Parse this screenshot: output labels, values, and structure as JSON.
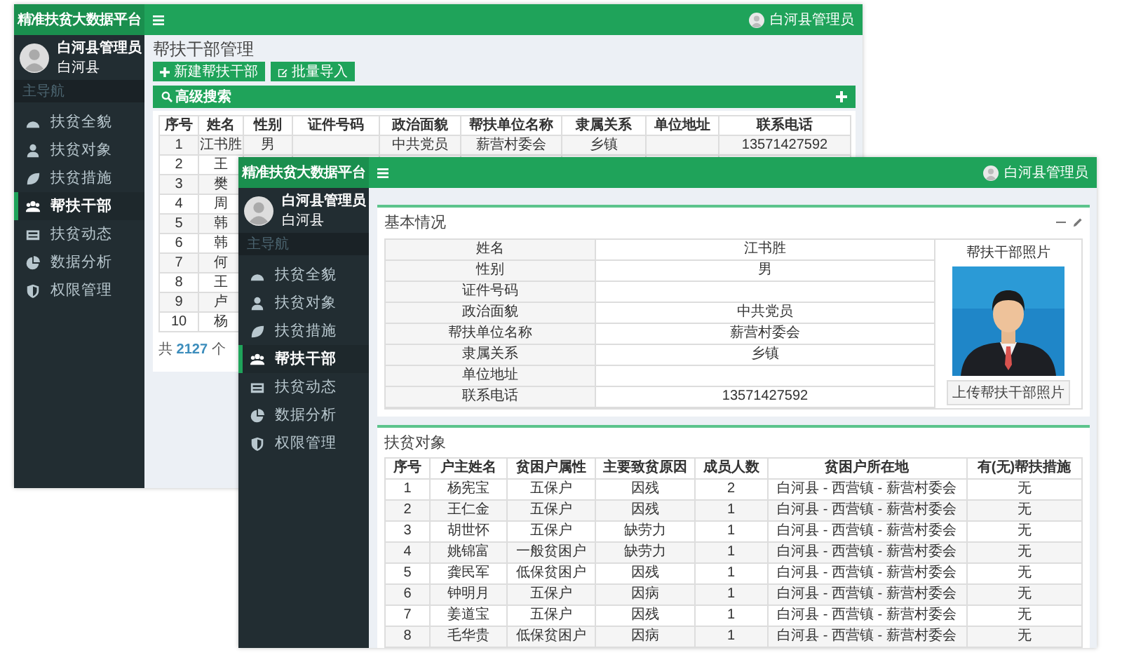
{
  "back_window": {
    "logo": "精准扶贫大数据平台",
    "header_user": "白河县管理员",
    "user_name": "白河县管理员",
    "user_county": "白河县",
    "nav_heading": "主导航",
    "nav_items": [
      {
        "label": "扶贫全貌",
        "selected": false
      },
      {
        "label": "扶贫对象",
        "selected": false
      },
      {
        "label": "扶贫措施",
        "selected": false
      },
      {
        "label": "帮扶干部",
        "selected": true
      },
      {
        "label": "扶贫动态",
        "selected": false
      },
      {
        "label": "数据分析",
        "selected": false
      },
      {
        "label": "权限管理",
        "selected": false
      }
    ],
    "page_title": "帮扶干部管理",
    "buttons": [
      "新建帮扶干部",
      "批量导入"
    ],
    "search_bar": "高级搜索",
    "table": {
      "columns": [
        "序号",
        "姓名",
        "性别",
        "证件号码",
        "政治面貌",
        "帮扶单位名称",
        "隶属关系",
        "单位地址",
        "联系电话"
      ],
      "rows": [
        [
          "1",
          "江书胜",
          "男",
          null,
          "中共党员",
          "薪营村委会",
          "乡镇",
          null,
          "13571427592"
        ],
        [
          "2",
          "王"
        ],
        [
          "3",
          "樊"
        ],
        [
          "4",
          "周"
        ],
        [
          "5",
          "韩"
        ],
        [
          "6",
          "韩"
        ],
        [
          "7",
          "何"
        ],
        [
          "8",
          "王"
        ],
        [
          "9",
          "卢"
        ],
        [
          "10",
          "杨"
        ]
      ]
    },
    "footer": "共 **2127** 个"
  },
  "front_window": {
    "logo": "精准扶贫大数据平台",
    "header_user": "白河县管理员",
    "user_name": "白河县管理员",
    "user_county": "白河县",
    "nav_heading": "主导航",
    "nav_items": [
      {
        "label": "扶贫全貌",
        "selected": false
      },
      {
        "label": "扶贫对象",
        "selected": false
      },
      {
        "label": "扶贫措施",
        "selected": false
      },
      {
        "label": "帮扶干部",
        "selected": true
      },
      {
        "label": "扶贫动态",
        "selected": false
      },
      {
        "label": "数据分析",
        "selected": false
      },
      {
        "label": "权限管理",
        "selected": false
      }
    ],
    "profile": {
      "title": "基本情况",
      "photo_title": "帮扶干部照片",
      "upload_button": "上传帮扶干部照片",
      "fields": [
        {
          "label": "姓名",
          "value": "江书胜"
        },
        {
          "label": "性别",
          "value": "男"
        },
        {
          "label": "证件号码"
        },
        {
          "label": "政治面貌",
          "value": "中共党员"
        },
        {
          "label": "帮扶单位名称",
          "value": "薪营村委会"
        },
        {
          "label": "隶属关系",
          "value": "乡镇"
        },
        {
          "label": "单位地址"
        },
        {
          "label": "联系电话",
          "value": "13571427592"
        }
      ]
    },
    "households": {
      "title": "扶贫对象",
      "columns": [
        "序号",
        "户主姓名",
        "贫困户属性",
        "主要致贫原因",
        "成员人数",
        "贫困户所在地",
        "有(无)帮扶措施"
      ],
      "rows": [
        [
          "1",
          "杨宪宝",
          "五保户",
          "因残",
          "2",
          "白河县 - 西营镇 - 薪营村委会",
          "无"
        ],
        [
          "2",
          "王仁金",
          "五保户",
          "因残",
          "1",
          "白河县 - 西营镇 - 薪营村委会",
          "无"
        ],
        [
          "3",
          "胡世怀",
          "五保户",
          "缺劳力",
          "1",
          "白河县 - 西营镇 - 薪营村委会",
          "无"
        ],
        [
          "4",
          "姚锦富",
          "一般贫困户",
          "缺劳力",
          "1",
          "白河县 - 西营镇 - 薪营村委会",
          "无"
        ],
        [
          "5",
          "龚民军",
          "低保贫困户",
          "因残",
          "1",
          "白河县 - 西营镇 - 薪营村委会",
          "无"
        ],
        [
          "6",
          "钟明月",
          "五保户",
          "因病",
          "1",
          "白河县 - 西营镇 - 薪营村委会",
          "无"
        ],
        [
          "7",
          "姜道宝",
          "五保户",
          "因残",
          "1",
          "白河县 - 西营镇 - 薪营村委会",
          "无"
        ],
        [
          "8",
          "毛华贵",
          "低保贫困户",
          "因病",
          "1",
          "白河县 - 西营镇 - 薪营村委会",
          "无"
        ]
      ]
    }
  }
}
